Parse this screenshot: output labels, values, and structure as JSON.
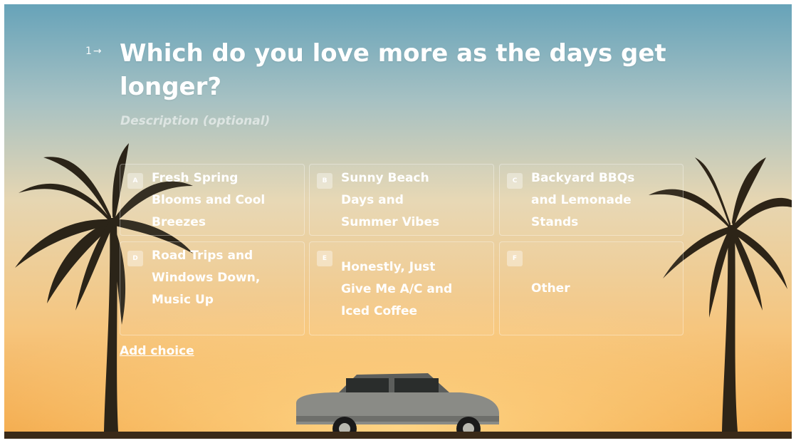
{
  "question": {
    "number": "1",
    "arrow": "→",
    "title": "Which do you love more as the days get longer?",
    "description_placeholder": "Description (optional)"
  },
  "choices": [
    {
      "key": "A",
      "label": "Fresh Spring Blooms and Cool Breezes"
    },
    {
      "key": "B",
      "label": "Sunny Beach Days and Summer Vibes"
    },
    {
      "key": "C",
      "label": "Backyard BBQs and Lemonade Stands"
    },
    {
      "key": "D",
      "label": "Road Trips and Windows Down, Music Up"
    },
    {
      "key": "E",
      "label": "Honestly, Just Give Me A/C and Iced Coffee"
    },
    {
      "key": "F",
      "label": "Other"
    }
  ],
  "add_choice_label": "Add choice",
  "background": {
    "sky_top": "#6fa5b8",
    "sky_mid": "#d9cfb0",
    "sky_bottom": "#f6b35c",
    "image_description_icon": "palm-sunset-car-image"
  }
}
